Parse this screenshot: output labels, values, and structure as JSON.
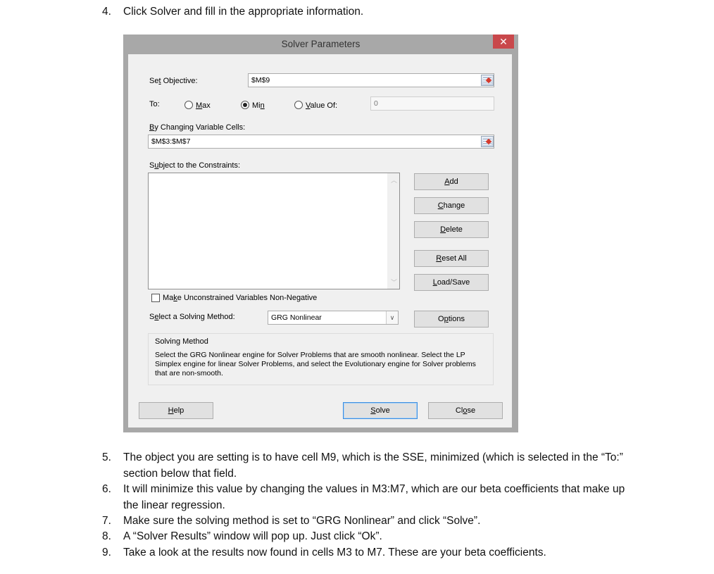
{
  "instructions_before": [
    {
      "number": "4.",
      "text": "Click Solver and fill in the appropriate information."
    }
  ],
  "dialog": {
    "title": "Solver Parameters",
    "close_icon": "close-icon",
    "set_objective": {
      "label_pre": "Se",
      "label_u": "t",
      "label_post": " Objective:",
      "value": "$M$9"
    },
    "to": {
      "label": "To:",
      "options": [
        {
          "pre": "",
          "u": "M",
          "post": "ax",
          "selected": false
        },
        {
          "pre": "Mi",
          "u": "n",
          "post": "",
          "selected": true
        },
        {
          "pre": "",
          "u": "V",
          "post": "alue Of:",
          "selected": false
        }
      ],
      "value_of": "0"
    },
    "changing_cells": {
      "label_pre": "",
      "label_u": "B",
      "label_post": "y Changing Variable Cells:",
      "value": "$M$3:$M$7"
    },
    "constraints": {
      "label_pre": "S",
      "label_u": "u",
      "label_post": "bject to the Constraints:",
      "items": []
    },
    "buttons": {
      "add": {
        "pre": "",
        "u": "A",
        "post": "dd"
      },
      "change": {
        "pre": "",
        "u": "C",
        "post": "hange"
      },
      "delete": {
        "pre": "",
        "u": "D",
        "post": "elete"
      },
      "reset_all": {
        "pre": "",
        "u": "R",
        "post": "eset All"
      },
      "load_save": {
        "pre": "",
        "u": "L",
        "post": "oad/Save"
      },
      "options": {
        "pre": "O",
        "u": "p",
        "post": "tions"
      },
      "help": {
        "pre": "",
        "u": "H",
        "post": "elp"
      },
      "solve": {
        "pre": "",
        "u": "S",
        "post": "olve"
      },
      "close": {
        "pre": "Cl",
        "u": "o",
        "post": "se"
      }
    },
    "nonnegative": {
      "pre": "Ma",
      "u": "k",
      "post": "e Unconstrained Variables Non-Negative",
      "checked": false
    },
    "solving_method": {
      "label_pre": "S",
      "label_u": "e",
      "label_post": "lect a Solving Method:",
      "value": "GRG Nonlinear"
    },
    "method_group": {
      "title": "Solving Method",
      "description": "Select the GRG Nonlinear engine for Solver Problems that are smooth nonlinear. Select the LP Simplex engine for linear Solver Problems, and select the Evolutionary engine for Solver problems that are non-smooth."
    }
  },
  "instructions_after": [
    {
      "number": "5.",
      "text": "The object you are setting is to have cell M9, which is the SSE, minimized (which is selected in the “To:” section below that field."
    },
    {
      "number": "6.",
      "text": "It will minimize this value by changing the values in M3:M7, which are our beta coefficients that make up the linear regression."
    },
    {
      "number": "7.",
      "text": "Make sure the solving method is set to “GRG Nonlinear” and click “Solve”."
    },
    {
      "number": "8.",
      "text": "A “Solver Results” window will pop up. Just click “Ok”."
    },
    {
      "number": "9.",
      "text": "Take a look at the results now found in cells M3 to M7. These are your beta coefficients."
    }
  ]
}
